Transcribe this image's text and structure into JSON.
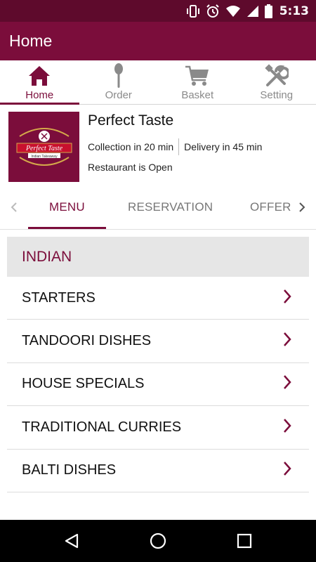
{
  "status_bar": {
    "time": "5:13",
    "icons": [
      "vibrate-icon",
      "alarm-icon",
      "wifi-icon",
      "signal-icon",
      "battery-icon"
    ]
  },
  "app_bar": {
    "title": "Home"
  },
  "bottom_tabs": [
    {
      "label": "Home",
      "icon": "home-icon",
      "active": true
    },
    {
      "label": "Order",
      "icon": "spoon-icon",
      "active": false
    },
    {
      "label": "Basket",
      "icon": "cart-icon",
      "active": false
    },
    {
      "label": "Setting",
      "icon": "tools-icon",
      "active": false
    }
  ],
  "restaurant": {
    "name": "Perfect Taste",
    "collection": "Collection in 20 min",
    "delivery": "Delivery in 45 min",
    "status": "Restaurant is Open",
    "logo": {
      "title": "Perfect Taste",
      "subtitle": "Indian Takeaway"
    }
  },
  "menu_tabs": {
    "items": [
      "MENU",
      "RESERVATION",
      "OFFER"
    ],
    "active": "MENU"
  },
  "category": {
    "title": "INDIAN"
  },
  "menu_items": [
    "STARTERS",
    "TANDOORI DISHES",
    "HOUSE SPECIALS",
    "TRADITIONAL CURRIES",
    "BALTI DISHES"
  ],
  "colors": {
    "brand": "#7b0d3b",
    "status_bar": "#5e0a2c",
    "header_bg": "#e6e6e6",
    "inactive_text": "#8a8a8a"
  },
  "nav_bar": {
    "buttons": [
      "back-icon",
      "home-circle-icon",
      "recents-icon"
    ]
  }
}
